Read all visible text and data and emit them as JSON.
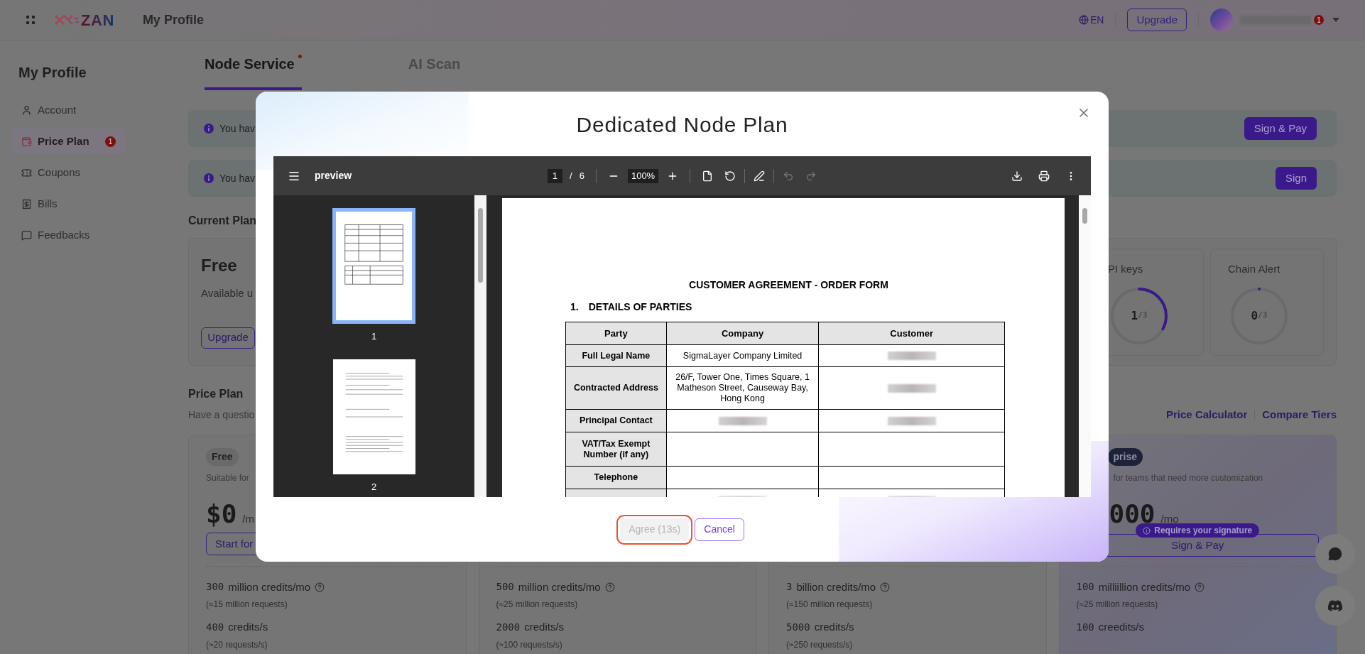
{
  "header": {
    "logo": "ZAN",
    "title": "My Profile",
    "language": "EN",
    "upgrade_button": "Upgrade",
    "user_badge": "1"
  },
  "sidebar": {
    "title": "My Profile",
    "items": [
      {
        "label": "Account",
        "selected": false
      },
      {
        "label": "Price Plan",
        "selected": true,
        "badge": "1"
      },
      {
        "label": "Coupons",
        "selected": false
      },
      {
        "label": "Bills",
        "selected": false
      },
      {
        "label": "Feedbacks",
        "selected": false
      }
    ]
  },
  "tabs": [
    {
      "label": "Node Service",
      "selected": true,
      "dot": true
    },
    {
      "label": "AI Scan",
      "selected": false,
      "dot": false
    }
  ],
  "alerts": [
    {
      "text": "You hav",
      "button": "Sign & Pay"
    },
    {
      "text": "You hav",
      "button": "Sign"
    }
  ],
  "current_plan": {
    "heading": "Current Plan",
    "name": "Free",
    "description": "Available u",
    "button": "Upgrade",
    "meters": [
      {
        "label": "PI keys",
        "value": "1",
        "total": "/3",
        "level": 0.33
      },
      {
        "label": "Chain Alert",
        "value": "0",
        "total": "/3",
        "level": 0
      }
    ]
  },
  "price_plan": {
    "heading": "Price Plan",
    "subtitle": "Have a questio",
    "links": [
      "Price Calculator",
      "Compare Tiers"
    ],
    "plans": [
      {
        "highlighted": false,
        "tag": "Free",
        "description": "Suitable for",
        "price": "$0",
        "unit": "/m",
        "button": "Start for",
        "features": [
          {
            "amount": "300",
            "unit": "million credits/mo",
            "help": true,
            "note": "(≈15 million requests)"
          },
          {
            "amount": "400",
            "unit": "credits/s",
            "help": false,
            "note": "(≈20 requests/s)"
          }
        ]
      },
      {
        "highlighted": false,
        "features": [
          {
            "amount": "500",
            "unit": "million credits/mo",
            "help": true,
            "note": "(≈25 million requests)"
          },
          {
            "amount": "2000",
            "unit": "credits/s",
            "help": false,
            "note": "(≈100 requests/s)"
          }
        ]
      },
      {
        "highlighted": false,
        "features": [
          {
            "amount": "3",
            "unit": "billion credits/mo",
            "help": true,
            "note": "(≈150 million requests)"
          },
          {
            "amount": "5000",
            "unit": "credits/s",
            "help": false,
            "note": "(≈250 requests/s)"
          }
        ]
      },
      {
        "highlighted": true,
        "tag": "prise",
        "description": "for teams that need more customization",
        "price": "000",
        "unit": "/mo",
        "signature_badge": "Requires your signature",
        "button": "Sign & Pay",
        "features": [
          {
            "amount": "100",
            "unit": "milliillion credits/mo",
            "help": true,
            "note": "(≈25 million requests)"
          },
          {
            "amount": "100",
            "unit": "creedits/s",
            "help": false
          }
        ]
      }
    ]
  },
  "dialog": {
    "title": "Dedicated Node Plan",
    "viewer": {
      "file_name": "preview",
      "page": "1",
      "page_separator": "/",
      "page_count": "6",
      "zoom": "100%",
      "tools": [
        {
          "kind": "fit",
          "disabled": false
        },
        {
          "kind": "rotate",
          "disabled": false
        },
        {
          "kind": "annotate",
          "disabled": false
        },
        {
          "kind": "undo",
          "disabled": true
        },
        {
          "kind": "redo",
          "disabled": true
        }
      ]
    },
    "thumbnails": [
      {
        "label": "1",
        "selected": true
      },
      {
        "label": "2",
        "selected": false
      }
    ],
    "document": {
      "title": "CUSTOMER AGREEMENT - ORDER FORM",
      "section_number": "1.",
      "section": "DETAILS OF PARTIES",
      "columns": [
        "Party",
        "Company",
        "Customer"
      ],
      "rows": [
        {
          "cells": [
            {
              "text": "Full Legal Name"
            },
            {
              "text": "SigmaLayer Company Limited"
            },
            {
              "redacted": true
            }
          ]
        },
        {
          "cells": [
            {
              "text": "Contracted Address"
            },
            {
              "text": "26/F, Tower One, Times Square, 1 Matheson Street, Causeway Bay, Hong Kong"
            },
            {
              "redacted": true
            }
          ]
        },
        {
          "cells": [
            {
              "text": "Principal Contact"
            },
            {
              "redacted": true
            },
            {
              "redacted": true
            }
          ]
        },
        {
          "cells": [
            {
              "text": "VAT/Tax Exempt Number (if any)"
            },
            {
              "redacted": false
            },
            {
              "redacted": false
            }
          ]
        },
        {
          "cells": [
            {
              "text": "Telephone"
            },
            {
              "redacted": false
            },
            {
              "redacted": false
            }
          ]
        },
        {
          "cells": [
            {
              "redacted": false
            },
            {
              "redacted": true
            },
            {
              "redacted": true
            }
          ]
        }
      ]
    },
    "buttons": [
      {
        "label": "Agree (13s)",
        "kind": "primary",
        "disabled": true,
        "highlighted": true
      },
      {
        "label": "Cancel",
        "kind": "secondary",
        "disabled": false,
        "highlighted": false
      }
    ]
  }
}
